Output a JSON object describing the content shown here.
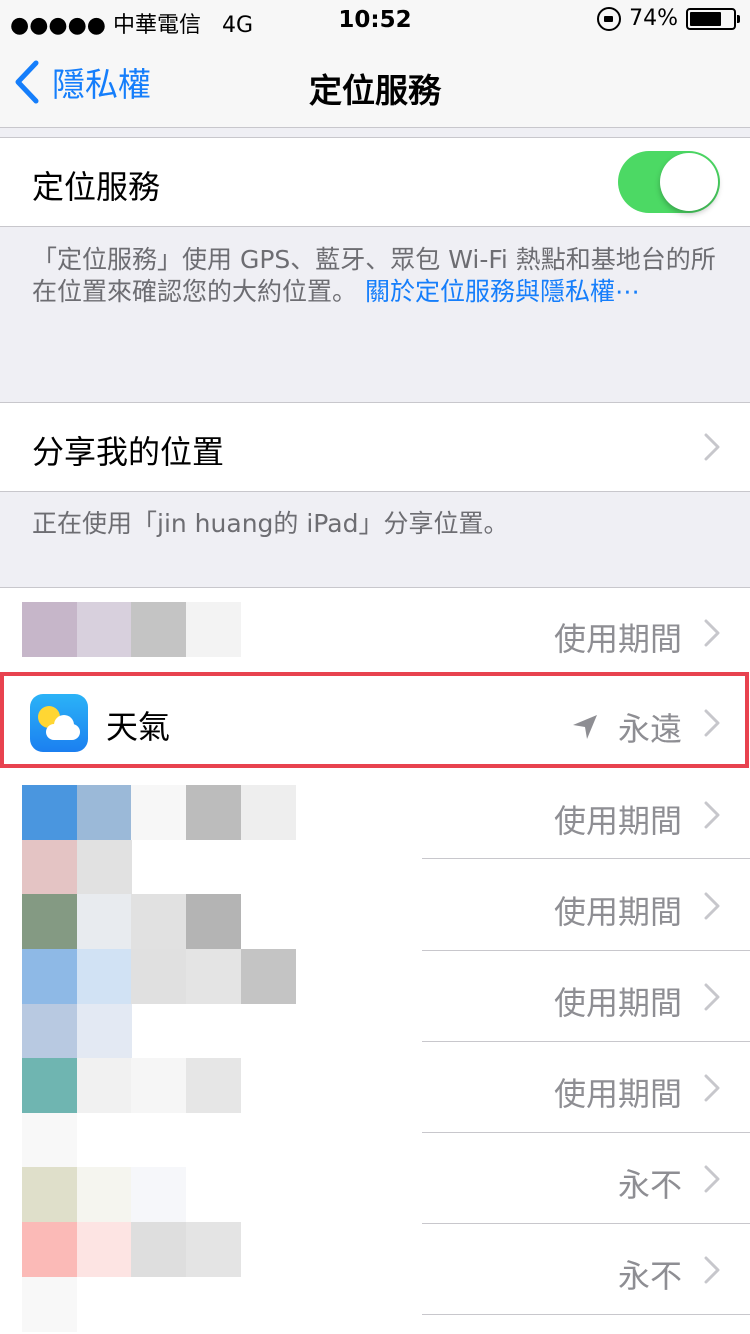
{
  "status_bar": {
    "carrier": "●●●●● 中華電信",
    "network": "4G",
    "time": "10:52",
    "battery": "74%",
    "battery_level": 0.74
  },
  "nav": {
    "back_label": "隱私權",
    "title": "定位服務"
  },
  "location_services": {
    "label": "定位服務",
    "toggle_on": true,
    "description": "「定位服務」使用 GPS、藍牙、眾包 Wi-Fi 熱點和基地台的所在位置來確認您的大約位置。",
    "link_text": "關於定位服務與隱私權⋯"
  },
  "share_location": {
    "label": "分享我的位置",
    "footer": "正在使用「jin huang的 iPad」分享位置。"
  },
  "apps": [
    {
      "name": "",
      "permission": "使用期間"
    },
    {
      "name": "天氣",
      "permission": "永遠",
      "icon": "weather-icon",
      "recently_used": true
    },
    {
      "name": "",
      "permission": "使用期間"
    },
    {
      "name": "",
      "permission": "使用期間"
    },
    {
      "name": "",
      "permission": "使用期間"
    },
    {
      "name": "",
      "permission": "使用期間"
    },
    {
      "name": "",
      "permission": "永不"
    },
    {
      "name": "",
      "permission": "永不"
    }
  ],
  "colors": {
    "accent": "#157efb",
    "toggle_on": "#4cd964",
    "highlight": "#e8424f",
    "secondary_text": "#8e8e93",
    "group_background": "#efeff4"
  }
}
